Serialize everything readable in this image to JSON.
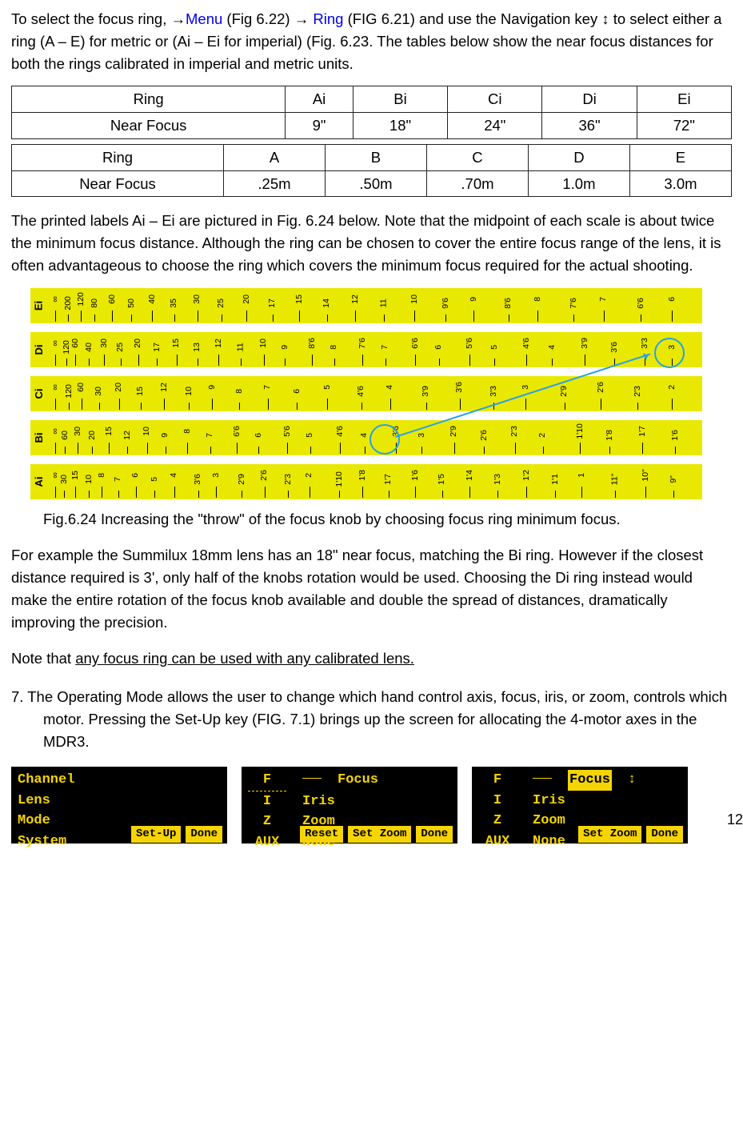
{
  "intro": {
    "t1a": "To select the focus ring, →",
    "menu": "Menu",
    "t1b": " (Fig 6.22) → ",
    "ring": "Ring",
    "t1c": " (FIG 6.21) and use the Navigation key ↕ to select either a ring (A – E) for metric or (Ai – Ei for imperial) (Fig. 6.23. The tables below show the near focus distances for both the rings calibrated in imperial and metric units."
  },
  "table1": {
    "h": "Ring",
    "c1": "Ai",
    "c2": "Bi",
    "c3": "Ci",
    "c4": "Di",
    "c5": "Ei",
    "r": "Near Focus",
    "v1": "9\"",
    "v2": "18\"",
    "v3": "24\"",
    "v4": "36\"",
    "v5": "72\""
  },
  "table2": {
    "h": "Ring",
    "c1": "A",
    "c2": "B",
    "c3": "C",
    "c4": "D",
    "c5": "E",
    "r": "Near Focus",
    "v1": ".25m",
    "v2": ".50m",
    "v3": ".70m",
    "v4": "1.0m",
    "v5": "3.0m"
  },
  "para2": "The printed labels Ai – Ei are pictured in Fig. 6.24 below. Note that the midpoint of each scale is about twice the minimum focus distance. Although the ring can be chosen to cover the entire focus range of the lens, it is often advantageous to choose the ring which covers the minimum focus required for the actual shooting.",
  "rulers": {
    "Ei": [
      "∞",
      "200",
      "120",
      "80",
      "60",
      "50",
      "40",
      "35",
      "30",
      "25",
      "20",
      "17",
      "15",
      "14",
      "12",
      "11",
      "10",
      "9'6",
      "9",
      "8'6",
      "8",
      "7'6",
      "7",
      "6'6",
      "6"
    ],
    "Di": [
      "∞",
      "120",
      "60",
      "40",
      "30",
      "25",
      "20",
      "17",
      "15",
      "13",
      "12",
      "11",
      "10",
      "9",
      "8'6",
      "8",
      "7'6",
      "7",
      "6'6",
      "6",
      "5'6",
      "5",
      "4'6",
      "4",
      "3'9",
      "3'6",
      "3'3",
      "3"
    ],
    "Ci": [
      "∞",
      "120",
      "60",
      "30",
      "20",
      "15",
      "12",
      "10",
      "9",
      "8",
      "7",
      "6",
      "5",
      "4'6",
      "4",
      "3'9",
      "3'6",
      "3'3",
      "3",
      "2'9",
      "2'6",
      "2'3",
      "2"
    ],
    "Bi": [
      "∞",
      "60",
      "30",
      "20",
      "15",
      "12",
      "10",
      "9",
      "8",
      "7",
      "6'6",
      "6",
      "5'6",
      "5",
      "4'6",
      "4",
      "3'6",
      "3",
      "2'9",
      "2'6",
      "2'3",
      "2",
      "1'10",
      "1'8",
      "1'7",
      "1'6"
    ],
    "Ai": [
      "∞",
      "30",
      "15",
      "10",
      "8",
      "7",
      "6",
      "5",
      "4",
      "3'6",
      "3",
      "2'9",
      "2'6",
      "2'3",
      "2",
      "1'10",
      "1'8",
      "1'7",
      "1'6",
      "1'5",
      "1'4",
      "1'3",
      "1'2",
      "1'1",
      "1",
      "11\"",
      "10\"",
      "9\""
    ]
  },
  "caption": "Fig.6.24 Increasing the \"throw\" of the focus knob by choosing focus ring minimum focus.",
  "para3": "For example the Summilux 18mm lens has an 18\" near focus, matching the Bi ring. However if the closest distance required is 3', only half of the knobs rotation would be used.  Choosing the Di ring instead would make the entire rotation of the focus knob available and double the spread of distances, dramatically improving the precision.",
  "note_a": "Note that ",
  "note_u": "any focus ring can be used with any calibrated lens.",
  "sec7_a": "7. The Operating Mode",
  "sec7_b": " allows the user to change which hand control axis, focus, iris, or zoom, controls which motor. Pressing the Set-Up key (FIG. 7.1) brings up the screen for allocating the 4-motor axes in the MDR3.",
  "lcd1": {
    "l1": "Channel",
    "l2": "Lens",
    "l3": "Mode",
    "l4": "System",
    "s1": "Set-Up",
    "s2": "Done"
  },
  "lcd2": {
    "r1a": "F",
    "r1b": "Focus",
    "r2a": "I",
    "r2b": "Iris",
    "r3a": "Z",
    "r3b": "Zoom",
    "r4a": "AUX",
    "r4b": "None",
    "s1": "Reset",
    "s2": "Set Zoom",
    "s3": "Done"
  },
  "lcd3": {
    "r1a": "F",
    "r1b": "Focus",
    "r2a": "I",
    "r2b": "Iris",
    "r3a": "Z",
    "r3b": "Zoom",
    "r4a": "AUX",
    "r4b": "None",
    "s2": "Set Zoom",
    "s3": "Done",
    "arrow": "↕"
  },
  "page": "12"
}
